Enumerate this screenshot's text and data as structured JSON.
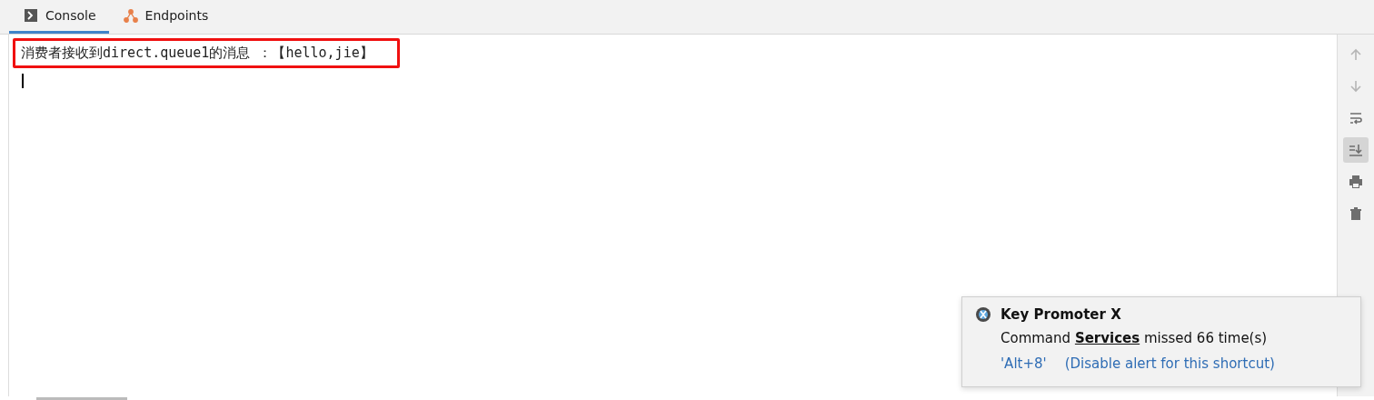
{
  "tabs": [
    {
      "label": "Console",
      "kind": "console",
      "selected": true
    },
    {
      "label": "Endpoints",
      "kind": "endpoints",
      "selected": false
    }
  ],
  "console": {
    "lines": [
      "消费者接收到direct.queue1的消息 ：【hello,jie】"
    ],
    "highlighted": true
  },
  "toolbar": [
    {
      "kind": "up",
      "disabled": true,
      "on": false
    },
    {
      "kind": "down",
      "disabled": true,
      "on": false
    },
    {
      "kind": "wrap",
      "disabled": false,
      "on": false
    },
    {
      "kind": "scroll",
      "disabled": false,
      "on": true
    },
    {
      "kind": "print",
      "disabled": false,
      "on": false
    },
    {
      "kind": "delete",
      "disabled": false,
      "on": false
    }
  ],
  "notification": {
    "title": "Key Promoter X",
    "message": "Command **Services** missed 66 time(s)",
    "links": [
      "'Alt+8'",
      "(Disable alert for this shortcut)"
    ]
  }
}
